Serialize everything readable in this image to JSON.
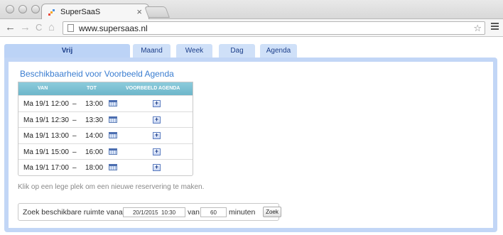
{
  "browser": {
    "tab_title": "SuperSaaS",
    "tab_close": "×",
    "url": "www.supersaas.nl",
    "back": "←",
    "forward": "→",
    "reload": "C",
    "home": "⌂",
    "star": "☆"
  },
  "views": {
    "tabs": [
      {
        "label": "Vrij"
      },
      {
        "label": "Maand"
      },
      {
        "label": "Week"
      },
      {
        "label": "Dag"
      },
      {
        "label": "Agenda"
      }
    ],
    "active": "Vrij"
  },
  "availability": {
    "title": "Beschikbaarheid voor Voorbeeld Agenda",
    "columns": [
      "VAN",
      "TOT",
      "VOORBEELD AGENDA"
    ],
    "dash": "–",
    "add_glyph": "+",
    "rows": [
      {
        "from": "Ma 19/1 12:00",
        "to": "13:00"
      },
      {
        "from": "Ma 19/1 12:30",
        "to": "13:30"
      },
      {
        "from": "Ma 19/1 13:00",
        "to": "14:00"
      },
      {
        "from": "Ma 19/1 15:00",
        "to": "16:00"
      },
      {
        "from": "Ma 19/1 17:00",
        "to": "18:00"
      }
    ]
  },
  "hint": "Klik op een lege plek om een nieuwe reservering te maken.",
  "search": {
    "label_prefix": "Zoek beschikbare ruimte vanaf",
    "datetime_value": "20/1/2015  10:30",
    "label_van": "van",
    "minutes_value": "60",
    "label_suffix": "minuten",
    "button": "Zoek"
  },
  "colors": {
    "frame": "#c2d6f6",
    "tab": "#cfe0f8",
    "table_header": "#7bbfd2",
    "title": "#3a7dd0"
  }
}
